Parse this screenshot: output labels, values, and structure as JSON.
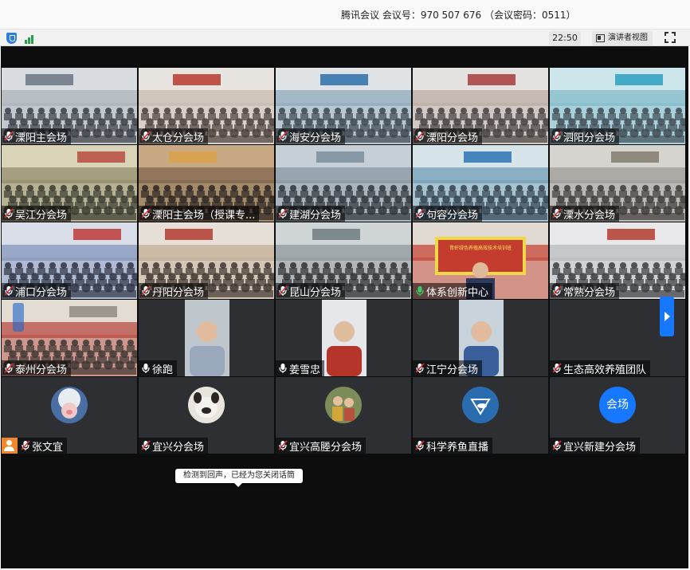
{
  "app": {
    "title": "腾讯会议 会议号：970 507 676 （会议密码：0511）",
    "clock": "22:50",
    "presenter_view_label": "演讲者视图",
    "accent_color": "#1677ff"
  },
  "tooltip": "检测到回声，已经为您关闭话筒",
  "tiles": [
    {
      "name": "溧阳主会场",
      "type": "video",
      "mic": "muted"
    },
    {
      "name": "太仓分会场",
      "type": "video",
      "mic": "muted"
    },
    {
      "name": "海安分会场",
      "type": "video",
      "mic": "muted"
    },
    {
      "name": "溧阳分会场",
      "type": "video",
      "mic": "muted"
    },
    {
      "name": "泗阳分会场",
      "type": "video",
      "mic": "muted"
    },
    {
      "name": "吴江分会场",
      "type": "video",
      "mic": "muted"
    },
    {
      "name": "溧阳主会场（授课专...",
      "type": "video",
      "mic": "muted"
    },
    {
      "name": "建湖分会场",
      "type": "video",
      "mic": "muted"
    },
    {
      "name": "句容分会场",
      "type": "video",
      "mic": "muted"
    },
    {
      "name": "溧水分会场",
      "type": "video",
      "mic": "muted"
    },
    {
      "name": "浦口分会场",
      "type": "video",
      "mic": "muted"
    },
    {
      "name": "丹阳分会场",
      "type": "video",
      "mic": "muted"
    },
    {
      "name": "昆山分会场",
      "type": "video",
      "mic": "muted"
    },
    {
      "name": "体系创新中心",
      "type": "video",
      "mic": "active",
      "banner_text": "青虾绿色养殖高效技术培训班"
    },
    {
      "name": "常熟分会场",
      "type": "video",
      "mic": "muted"
    },
    {
      "name": "泰州分会场",
      "type": "video",
      "mic": "muted"
    },
    {
      "name": "徐跑",
      "type": "portrait",
      "mic": "on"
    },
    {
      "name": "姜雪忠",
      "type": "portrait",
      "mic": "on"
    },
    {
      "name": "江宁分会场",
      "type": "portrait",
      "mic": "muted"
    },
    {
      "name": "生态高效养殖团队",
      "type": "empty",
      "mic": "muted"
    },
    {
      "name": "张文宜",
      "type": "avatar",
      "mic": "muted",
      "host": true,
      "avatar_icon": "pig-hat-avatar-icon"
    },
    {
      "name": "宜兴分会场",
      "type": "avatar",
      "mic": "muted",
      "avatar_icon": "bulldog-avatar-icon"
    },
    {
      "name": "宜兴高塍分会场",
      "type": "avatar",
      "mic": "muted",
      "avatar_icon": "children-photo-avatar-icon"
    },
    {
      "name": "科学养鱼直播",
      "type": "avatar",
      "mic": "muted",
      "avatar_icon": "fish-logo-avatar-icon"
    },
    {
      "name": "宜兴新建分会场",
      "type": "avatar",
      "mic": "muted",
      "avatar_text": "会场"
    }
  ]
}
